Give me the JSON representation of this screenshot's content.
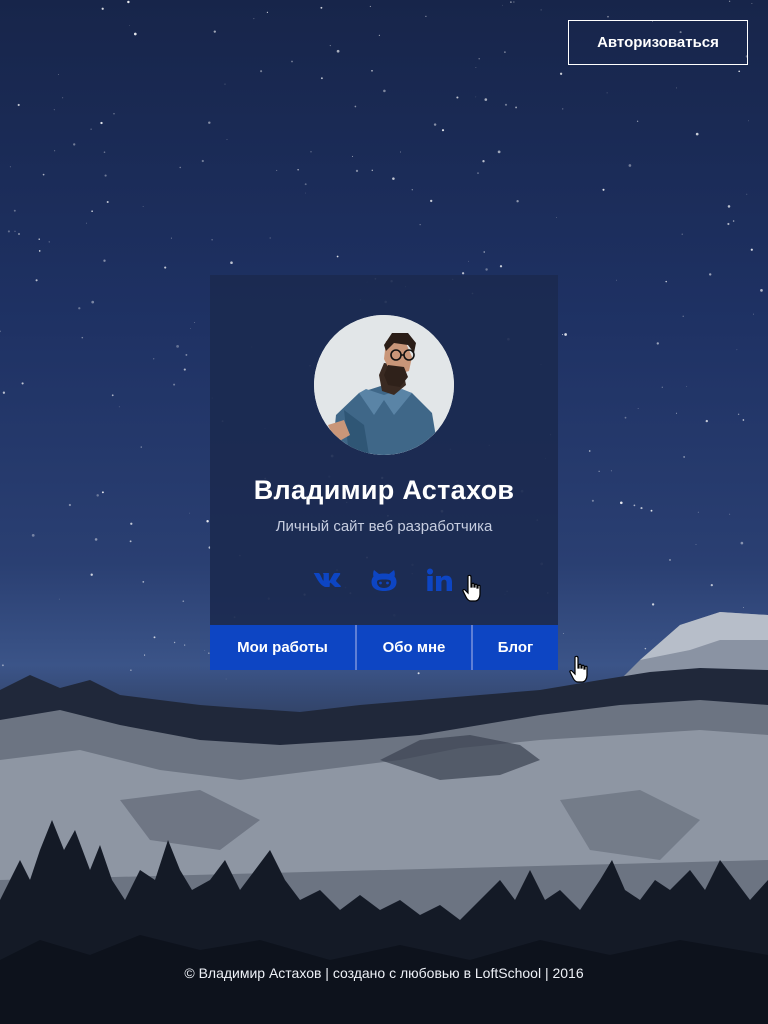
{
  "header": {
    "auth_label": "Авторизоваться"
  },
  "profile": {
    "name": "Владимир Астахов",
    "subtitle": "Личный сайт веб разработчика"
  },
  "social": [
    {
      "icon": "vk-icon"
    },
    {
      "icon": "github-icon"
    },
    {
      "icon": "linkedin-icon"
    }
  ],
  "nav": {
    "works_label": "Мои работы",
    "about_label": "Обо мне",
    "blog_label": "Блог"
  },
  "footer": {
    "text": "© Владимир Астахов | создано с любовью в LoftSchool | 2016"
  },
  "colors": {
    "accent": "#0d45c3",
    "icon": "#0d45c3",
    "card": "#1b2a50"
  }
}
